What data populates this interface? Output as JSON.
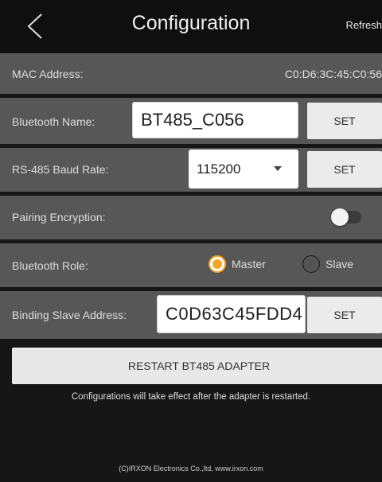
{
  "header": {
    "title": "Configuration",
    "refresh_label": "Refresh",
    "back_icon": "chevron-left-icon"
  },
  "mac": {
    "label": "MAC Address:",
    "value": "C0:D6:3C:45:C0:56"
  },
  "bluetooth_name": {
    "label": "Bluetooth Name:",
    "value": "BT485_C056",
    "set_label": "SET"
  },
  "baud_rate": {
    "label": "RS-485 Baud Rate:",
    "selected": "115200",
    "set_label": "SET"
  },
  "pairing": {
    "label": "Pairing Encryption:",
    "enabled": false
  },
  "role": {
    "label": "Bluetooth Role:",
    "options": [
      "Master",
      "Slave"
    ],
    "selected": "Master"
  },
  "binding": {
    "label": "Binding Slave Address:",
    "value": "C0D63C45FDD4",
    "set_label": "SET"
  },
  "restart_label": "RESTART BT485 ADAPTER",
  "note": "Configurations will take effect after the adapter is restarted.",
  "footer": "(C)IRXON Electronics Co.,ltd,  www.irxon.com",
  "colors": {
    "accent": "#f5a623",
    "row_bg": "#575757",
    "screen_bg": "#161616"
  }
}
